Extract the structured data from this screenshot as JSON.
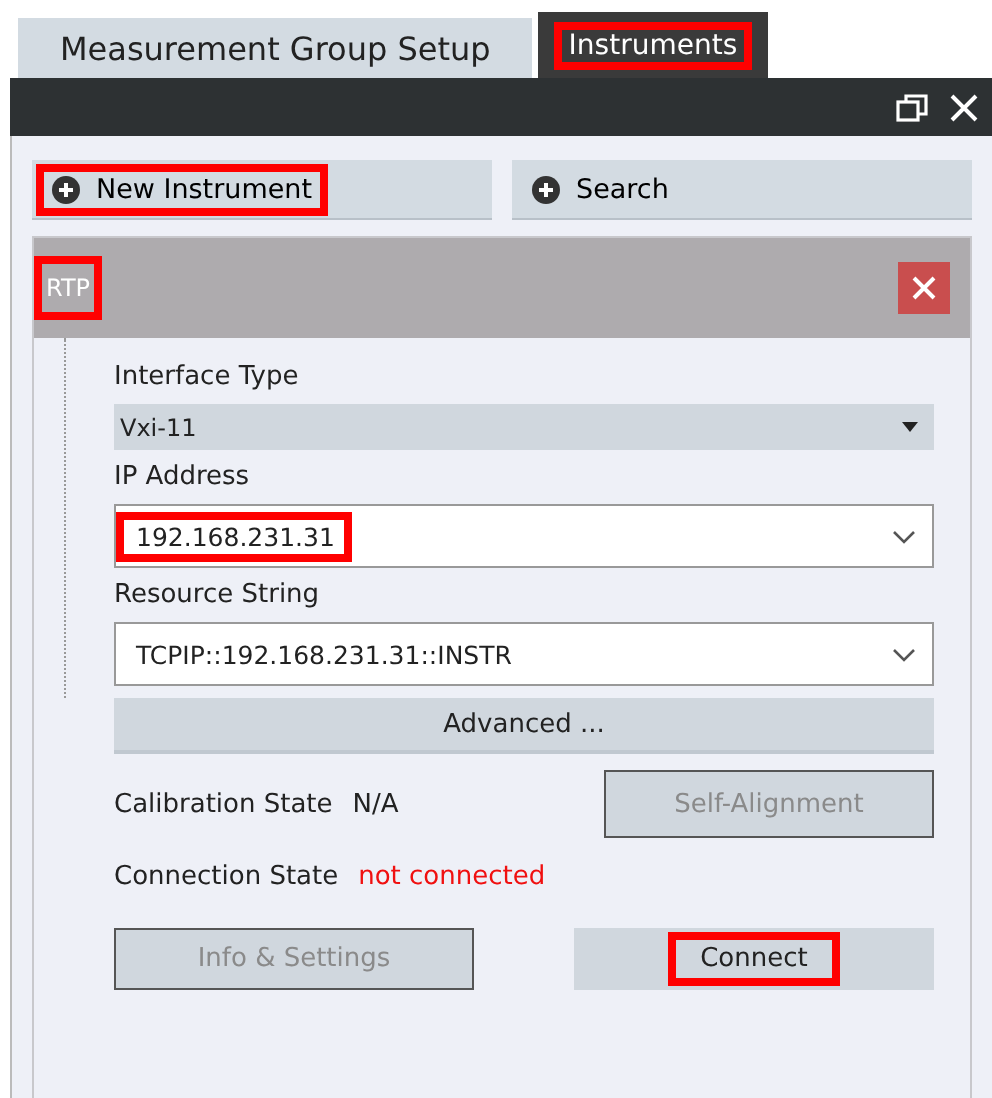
{
  "tabs": [
    {
      "label": "Measurement Group Setup",
      "selected": false,
      "highlighted": false
    },
    {
      "label": "Instruments",
      "selected": true,
      "highlighted": true
    }
  ],
  "toolbar": [
    {
      "label": "New Instrument",
      "highlighted": true
    },
    {
      "label": "Search",
      "highlighted": false
    }
  ],
  "instrument": {
    "name": "RTP",
    "highlighted": true,
    "fields": [
      {
        "kind": "dropdown",
        "label": "Interface Type",
        "value": "Vxi-11",
        "highlighted": false
      },
      {
        "kind": "combo",
        "label": "IP Address",
        "value": "192.168.231.31",
        "highlighted": true
      },
      {
        "kind": "combo",
        "label": "Resource String",
        "value": "TCPIP::192.168.231.31::INSTR",
        "highlighted": false
      }
    ],
    "advanced_button": {
      "label": "Advanced ..."
    },
    "calibration": {
      "label": "Calibration State",
      "value": "N/A"
    },
    "self_alignment_button": {
      "label": "Self-Alignment",
      "disabled": true
    },
    "connection": {
      "label": "Connection State",
      "value": "not connected",
      "connected": false
    },
    "info_button": {
      "label": "Info & Settings",
      "disabled": true,
      "highlighted": false
    },
    "connect_button": {
      "label": "Connect",
      "disabled": false,
      "highlighted": true
    }
  }
}
